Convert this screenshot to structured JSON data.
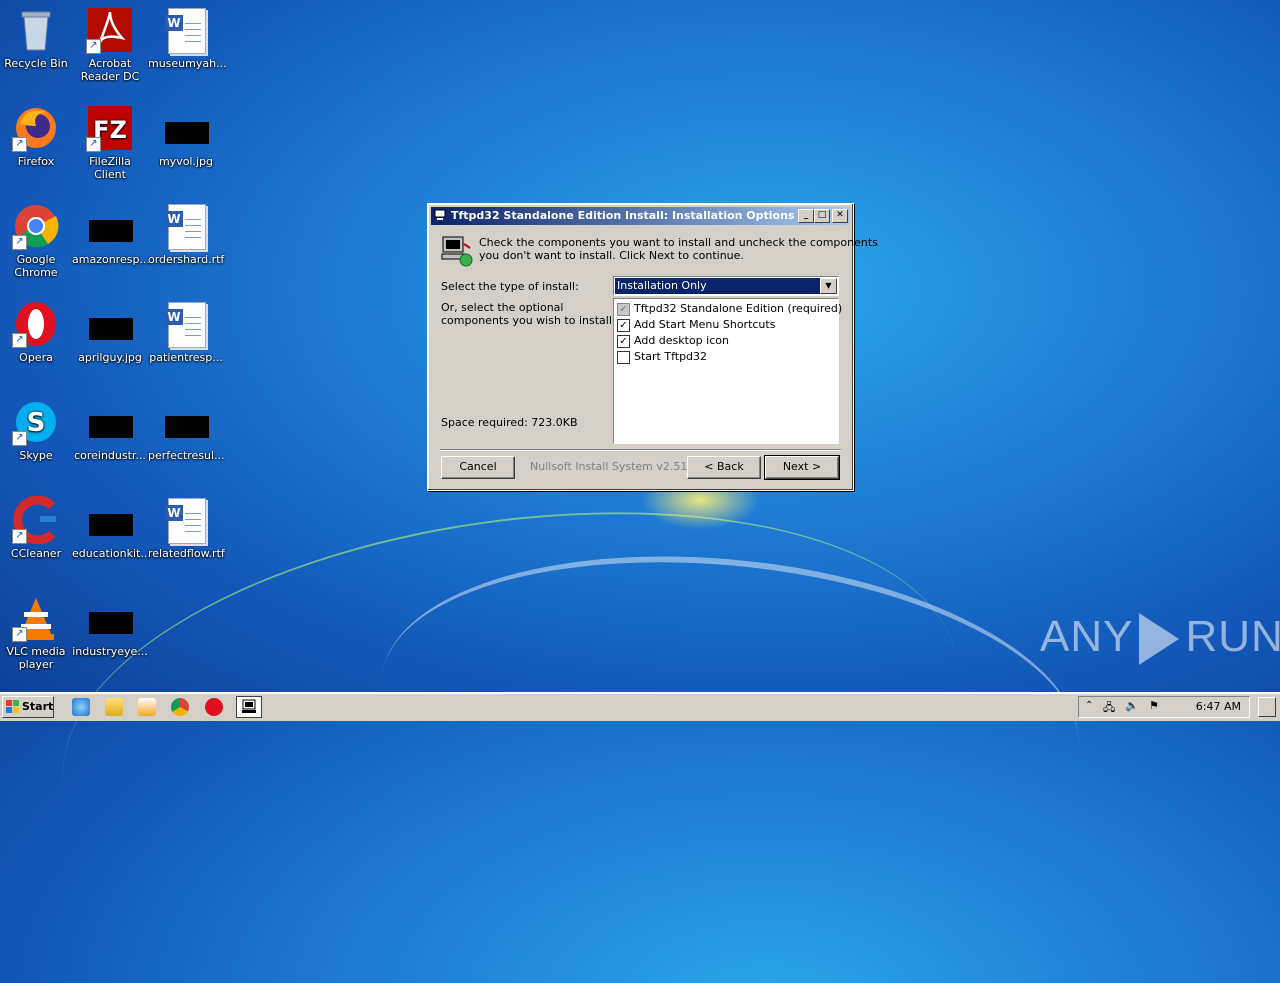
{
  "desktop": {
    "icons": [
      {
        "label": "Recycle Bin",
        "icon": "recycle-bin-icon"
      },
      {
        "label": "Acrobat Reader DC",
        "icon": "acrobat-icon"
      },
      {
        "label": "museumyah...",
        "icon": "word-document-icon"
      },
      {
        "label": "Firefox",
        "icon": "firefox-icon"
      },
      {
        "label": "FileZilla Client",
        "icon": "filezilla-icon"
      },
      {
        "label": "myvol.jpg",
        "icon": "image-thumbnail-icon"
      },
      {
        "label": "Google Chrome",
        "icon": "chrome-icon"
      },
      {
        "label": "amazonresp...",
        "icon": "image-thumbnail-icon"
      },
      {
        "label": "ordershard.rtf",
        "icon": "word-document-icon"
      },
      {
        "label": "Opera",
        "icon": "opera-icon"
      },
      {
        "label": "aprilguy.jpg",
        "icon": "image-thumbnail-icon"
      },
      {
        "label": "patientresp...",
        "icon": "word-document-icon"
      },
      {
        "label": "Skype",
        "icon": "skype-icon"
      },
      {
        "label": "coreindustr...",
        "icon": "image-thumbnail-icon"
      },
      {
        "label": "perfectresul...",
        "icon": "image-thumbnail-icon"
      },
      {
        "label": "CCleaner",
        "icon": "ccleaner-icon"
      },
      {
        "label": "educationkit...",
        "icon": "image-thumbnail-icon"
      },
      {
        "label": "relatedflow.rtf",
        "icon": "word-document-icon"
      },
      {
        "label": "VLC media player",
        "icon": "vlc-icon"
      },
      {
        "label": "industryeye...",
        "icon": "image-thumbnail-icon"
      }
    ]
  },
  "dialog": {
    "title": "Tftpd32 Standalone Edition Install: Installation Options",
    "description_line1": "Check the components you want to install and uncheck the components",
    "description_line2": "you don't want to install. Click Next to continue.",
    "type_label": "Select the type of install:",
    "type_selected": "Installation Only",
    "optional_label_line1": "Or, select the optional",
    "optional_label_line2": "components you wish to install:",
    "components": [
      {
        "label": "Tftpd32 Standalone Edition (required)",
        "checked": true,
        "disabled": true
      },
      {
        "label": "Add Start Menu Shortcuts",
        "checked": true,
        "disabled": false
      },
      {
        "label": "Add desktop icon",
        "checked": true,
        "disabled": false
      },
      {
        "label": "Start Tftpd32",
        "checked": false,
        "disabled": false
      }
    ],
    "space_required": "Space required: 723.0KB",
    "branding": "Nullsoft Install System v2.51",
    "cancel_label": "Cancel",
    "back_label": "< Back",
    "next_label": "Next >"
  },
  "taskbar": {
    "start_label": "Start",
    "clock": "6:47 AM"
  },
  "watermark": {
    "left": "ANY",
    "right": "RUN"
  }
}
